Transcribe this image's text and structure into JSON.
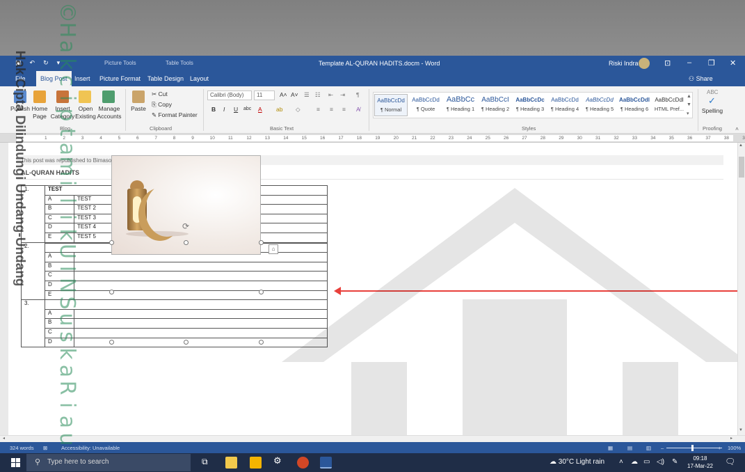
{
  "watermark": {
    "side_text": "Hak Cipta Dilindungi Undang-Undang",
    "letters": [
      "©",
      "H",
      "a",
      "k",
      "c",
      "i",
      "p",
      "t",
      "a",
      "m",
      "i",
      "l",
      "i",
      "k",
      "U",
      "I",
      "N",
      "S",
      "u",
      "s",
      "k",
      "a",
      "R",
      "i",
      "a",
      "u"
    ]
  },
  "titlebar": {
    "context_picture": "Picture Tools",
    "context_table": "Table Tools",
    "title": "Template AL-QURAN HADITS.docm - Word",
    "user": "Riski Indra"
  },
  "tabs": [
    "File",
    "Blog Post",
    "Insert",
    "Picture Format",
    "Table Design",
    "Layout"
  ],
  "share_label": "Share",
  "ribbon": {
    "blog_buttons": [
      "Publish",
      "Home Page",
      "Insert Category",
      "Open Existing",
      "Manage Accounts"
    ],
    "blog_group": "Blog",
    "clipboard": {
      "paste": "Paste",
      "cut": "Cut",
      "copy": "Copy",
      "format_painter": "Format Painter",
      "group": "Clipboard"
    },
    "font": {
      "name": "Calibri (Body)",
      "size": "11",
      "group": "Basic Text"
    },
    "styles": [
      {
        "preview": "AaBbCcDd",
        "name": "¶ Normal"
      },
      {
        "preview": "AaBbCcDd",
        "name": "¶ Quote"
      },
      {
        "preview": "AaBbCc",
        "name": "¶ Heading 1"
      },
      {
        "preview": "AaBbCcI",
        "name": "¶ Heading 2"
      },
      {
        "preview": "AaBbCcDc",
        "name": "¶ Heading 3"
      },
      {
        "preview": "AaBbCcDd",
        "name": "¶ Heading 4"
      },
      {
        "preview": "AaBbCcDd",
        "name": "¶ Heading 5"
      },
      {
        "preview": "AaBbCcDdl",
        "name": "¶ Heading 6"
      },
      {
        "preview": "AaBbCcDdl",
        "name": "HTML Pref..."
      }
    ],
    "styles_group": "Styles",
    "spelling": "Spelling",
    "proofing_group": "Proofing"
  },
  "ruler_numbers": [
    "1",
    "2",
    "3",
    "4",
    "5",
    "6",
    "7",
    "8",
    "9",
    "10",
    "11",
    "12",
    "13",
    "14",
    "15",
    "16",
    "17",
    "18",
    "19",
    "20",
    "21",
    "22",
    "23",
    "24",
    "25",
    "26",
    "27",
    "28",
    "29",
    "30",
    "31",
    "32",
    "33",
    "34",
    "35",
    "36",
    "37",
    "38",
    "39"
  ],
  "document": {
    "notice": "This post was republished to Bimasoft Cloud CBT at 10:01:58 AM 3/9/2022",
    "heading": "AL-QURAN HADITS",
    "questions": [
      {
        "number": "1.",
        "text": "TEST",
        "options": [
          [
            "A",
            "TEST"
          ],
          [
            "B",
            "TEST 2"
          ],
          [
            "C",
            "TEST 3"
          ],
          [
            "D",
            "TEST 4"
          ],
          [
            "E",
            "TEST 5"
          ]
        ]
      },
      {
        "number": "2.",
        "text": "",
        "options": [
          [
            "A",
            ""
          ],
          [
            "B",
            ""
          ],
          [
            "C",
            ""
          ],
          [
            "D",
            ""
          ],
          [
            "E",
            ""
          ]
        ]
      },
      {
        "number": "3.",
        "text": "",
        "options": [
          [
            "A",
            ""
          ],
          [
            "B",
            ""
          ],
          [
            "C",
            ""
          ],
          [
            "D",
            ""
          ]
        ]
      }
    ]
  },
  "status": {
    "words": "324 words",
    "accessibility": "Accessibility: Unavailable",
    "zoom": "100%"
  },
  "taskbar": {
    "search_placeholder": "Type here to search",
    "weather": "30°C Light rain",
    "time": "09:18",
    "date": "17-Mar-22"
  },
  "colors": {
    "word_blue": "#2b579a",
    "arrow_red": "#e8403b",
    "watermark_green": "#288c5a"
  }
}
